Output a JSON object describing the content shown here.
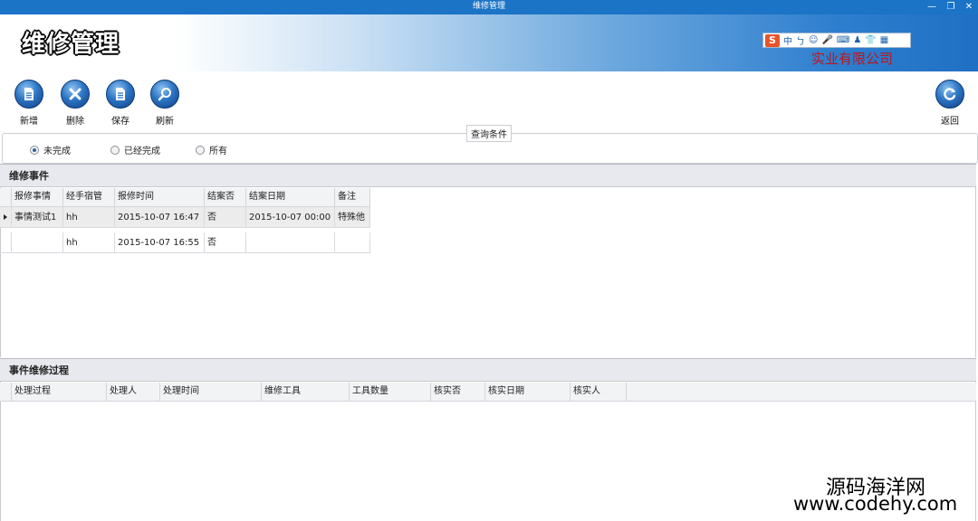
{
  "window": {
    "title": "维修管理"
  },
  "header": {
    "title": "维修管理",
    "company": "实业有限公司",
    "ime_items": [
      "中",
      "ㄅ",
      "☺",
      "🎤",
      "⌨",
      "♟",
      "👕",
      "▦"
    ]
  },
  "toolbar": {
    "add_label": "新增",
    "delete_label": "删除",
    "save_label": "保存",
    "refresh_label": "刷新",
    "back_label": "返回"
  },
  "query": {
    "legend": "查询条件",
    "options": [
      "未完成",
      "已经完成",
      "所有"
    ],
    "selected": "未完成"
  },
  "events": {
    "title": "维修事件",
    "columns": [
      "报修事情",
      "经手宿管",
      "报修时间",
      "结案否",
      "结案日期",
      "备注"
    ],
    "rows": [
      [
        "事情测试1",
        "hh",
        "2015-10-07 16:47",
        "否",
        "2015-10-07 00:00",
        "特殊他"
      ],
      [
        "",
        "hh",
        "2015-10-07 16:55",
        "否",
        "",
        ""
      ]
    ]
  },
  "process": {
    "title": "事件维修过程",
    "columns": [
      "处理过程",
      "处理人",
      "处理时间",
      "维修工具",
      "工具数量",
      "核实否",
      "核实日期",
      "核实人"
    ]
  },
  "watermark": {
    "line1": "源码海洋网",
    "line2": "www.codehy.com"
  },
  "colors": {
    "titlebar": "#1b74c6",
    "company": "#c0141a",
    "toolbar_icon": "#2c76c4"
  }
}
